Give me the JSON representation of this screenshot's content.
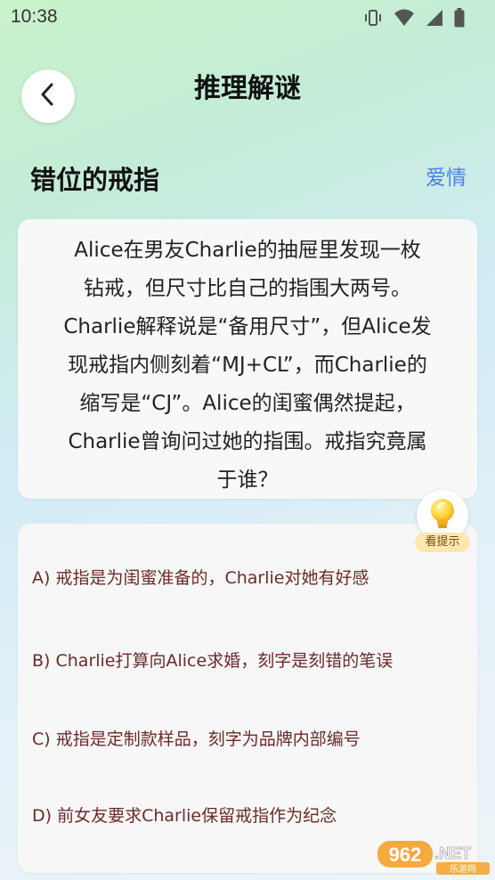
{
  "status_bar": {
    "time": "10:38",
    "icons": [
      "vibrate-icon",
      "wifi-icon",
      "signal-icon",
      "battery-icon"
    ]
  },
  "header": {
    "title": "推理解谜",
    "back_icon": "chevron-left-icon"
  },
  "puzzle": {
    "title": "错位的戒指",
    "category": "爱情",
    "question_lines": [
      "Alice在男友Charlie的抽屉里发现一枚",
      "钻戒，但尺寸比自己的指围大两号。",
      "Charlie解释说是“备用尺寸”，但Alice发",
      "现戒指内侧刻着“MJ+CL”，而Charlie的",
      "缩写是“CJ”。Alice的闺蜜偶然提起，",
      "Charlie曾询问过她的指围。戒指究竟属",
      "于谁？"
    ]
  },
  "hint": {
    "label": "看提示",
    "icon": "lightbulb-icon"
  },
  "options": [
    "A) 戒指是为闺蜜准备的，Charlie对她有好感",
    "B) Charlie打算向Alice求婚，刻字是刻错的笔误",
    "C) 戒指是定制款样品，刻字为品牌内部编号",
    "D) 前女友要求Charlie保留戒指作为纪念"
  ],
  "watermark": {
    "number": "962",
    "suffix": ".NET",
    "subtitle": "乐游网"
  },
  "colors": {
    "accent_blue": "#4f7fe6",
    "option_text": "#6b2a2a",
    "hint_badge": "#fde7b0"
  }
}
